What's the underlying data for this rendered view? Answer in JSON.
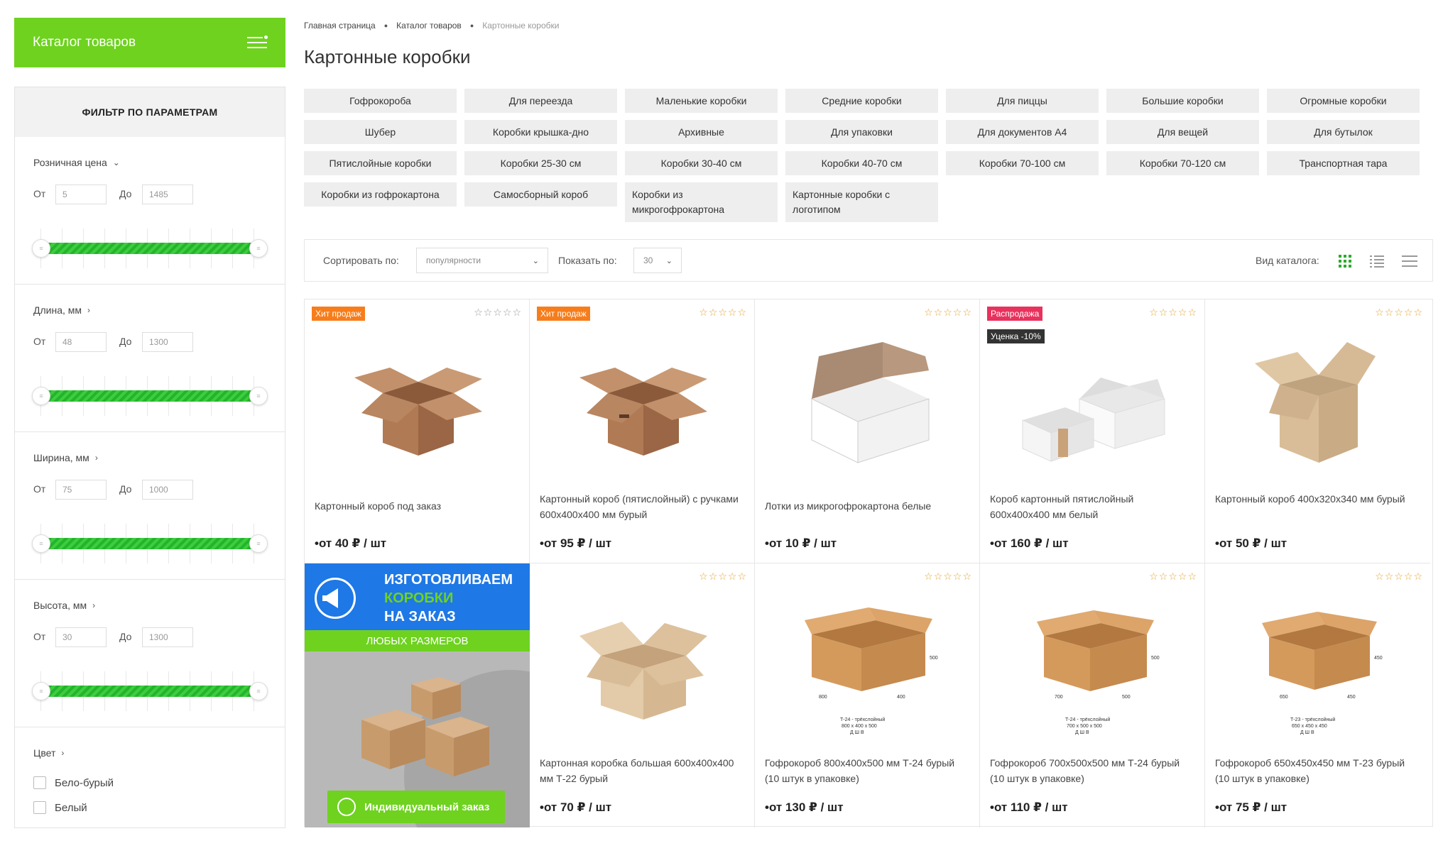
{
  "sidebar": {
    "catalog_label": "Каталог товаров",
    "filter_title": "ФИЛЬТР ПО ПАРАМЕТРАМ",
    "from_label": "От",
    "to_label": "До",
    "filters": [
      {
        "title": "Розничная цена",
        "from": "5",
        "to": "1485"
      },
      {
        "title": "Длина, мм",
        "from": "48",
        "to": "1300"
      },
      {
        "title": "Ширина, мм",
        "from": "75",
        "to": "1000"
      },
      {
        "title": "Высота, мм",
        "from": "30",
        "to": "1300"
      }
    ],
    "color": {
      "title": "Цвет",
      "options": [
        "Бело-бурый",
        "Белый"
      ]
    }
  },
  "breadcrumb": [
    "Главная страница",
    "Каталог товаров",
    "Картонные коробки"
  ],
  "page_title": "Картонные коробки",
  "tags": [
    "Гофрокороба",
    "Для переезда",
    "Маленькие коробки",
    "Средние коробки",
    "Для пиццы",
    "Большие коробки",
    "Огромные коробки",
    "Шубер",
    "Коробки крышка-дно",
    "Архивные",
    "Для упаковки",
    "Для документов А4",
    "Для вещей",
    "Для бутылок",
    "Пятислойные коробки",
    "Коробки 25-30 см",
    "Коробки 30-40 см",
    "Коробки 40-70 см",
    "Коробки 70-100 см",
    "Коробки 70-120 см",
    "Транспортная тара",
    "Коробки из гофрокартона",
    "Самосборный короб",
    "Коробки из микрогофрокартона",
    "Картонные коробки с логотипом"
  ],
  "toolbar": {
    "sort_label": "Сортировать по:",
    "sort_value": "популярности",
    "show_label": "Показать по:",
    "show_value": "30",
    "view_label": "Вид каталога:"
  },
  "products": [
    {
      "name": "Картонный короб под заказ",
      "price": "•от 40 ₽ / шт",
      "badge": "Хит продаж"
    },
    {
      "name": "Картонный короб (пятислойный) с ручками 600х400х400 мм бурый",
      "price": "•от 95 ₽ / шт",
      "badge": "Хит продаж"
    },
    {
      "name": "Лотки из микрогофрокартона белые",
      "price": "•от 10 ₽ / шт",
      "badge": ""
    },
    {
      "name": "Короб картонный пятислойный 600х400х400 мм белый",
      "price": "•от 160 ₽ / шт",
      "badge": "Распродажа",
      "badge2": "Уценка -10%"
    },
    {
      "name": "Картонный короб 400х320х340 мм бурый",
      "price": "•от 50 ₽ / шт",
      "badge": ""
    },
    {
      "name": "Картонная коробка большая 600х400х400 мм Т-22 бурый",
      "price": "•от 70 ₽ / шт",
      "badge": ""
    },
    {
      "name": "Гофрокороб 800х400х500 мм Т-24 бурый (10 штук в упаковке)",
      "price": "•от 130 ₽ / шт",
      "badge": ""
    },
    {
      "name": "Гофрокороб 700х500х500 мм Т-24 бурый (10 штук в упаковке)",
      "price": "•от 110 ₽ / шт",
      "badge": ""
    },
    {
      "name": "Гофрокороб 650х450х450 мм Т-23 бурый (10 штук в упаковке)",
      "price": "•от 75 ₽ / шт",
      "badge": ""
    }
  ],
  "promo": {
    "line1": "ИЗГОТОВЛИВАЕМ",
    "line2": "КОРОБКИ",
    "line3": "НА ЗАКАЗ",
    "band": "ЛЮБЫХ РАЗМЕРОВ",
    "button": "Индивидуальный заказ"
  },
  "ratings": "☆☆☆☆☆",
  "colors": {
    "accent": "#6ed21f",
    "hit": "#f77d1b",
    "sale": "#e8325d",
    "slider": "#22b52c",
    "promo_blue": "#1e78e6"
  }
}
